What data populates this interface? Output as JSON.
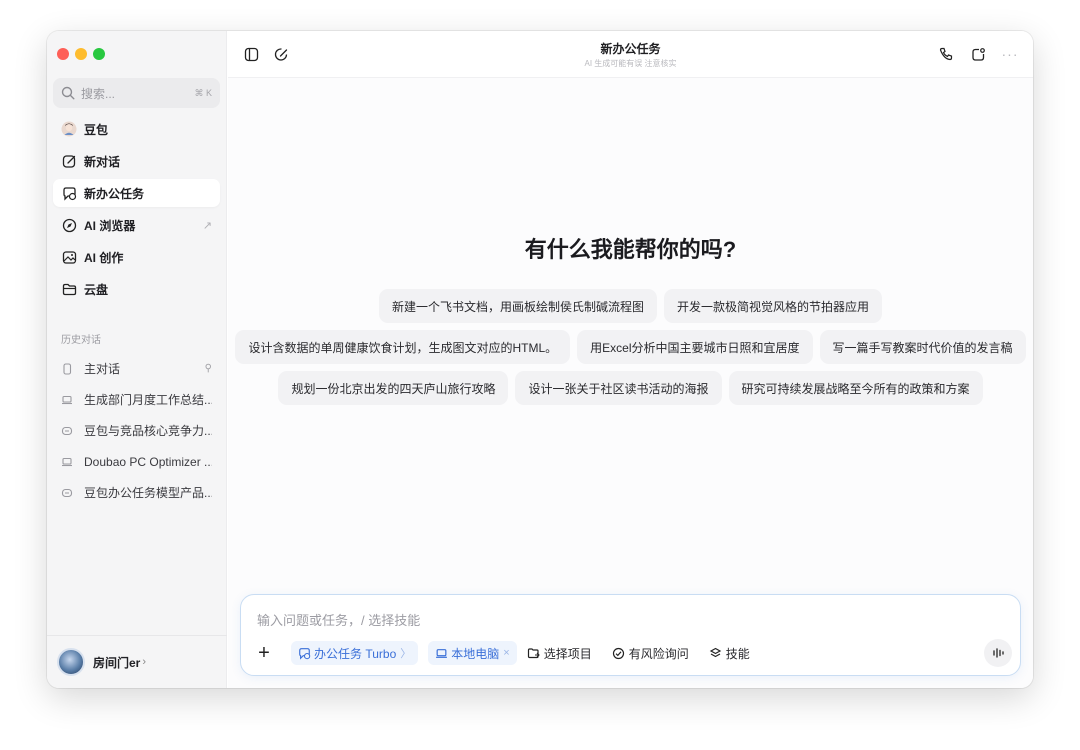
{
  "sidebar": {
    "search": {
      "placeholder": "搜索...",
      "shortcut": "⌘ K"
    },
    "nav": [
      {
        "label": "豆包",
        "icon": "doubao-avatar-icon"
      },
      {
        "label": "新对话",
        "icon": "new-chat-icon"
      },
      {
        "label": "新办公任务",
        "icon": "office-task-icon",
        "active": true
      },
      {
        "label": "AI 浏览器",
        "icon": "compass-icon",
        "ext": "↗"
      },
      {
        "label": "AI 创作",
        "icon": "image-icon"
      },
      {
        "label": "云盘",
        "icon": "folder-icon"
      }
    ],
    "history_title": "历史对话",
    "history": [
      {
        "label": "主对话",
        "icon": "phone-icon",
        "pin": "⚲"
      },
      {
        "label": "生成部门月度工作总结...",
        "icon": "laptop-icon"
      },
      {
        "label": "豆包与竞品核心竞争力...",
        "icon": "chat-bubble-icon"
      },
      {
        "label": "Doubao PC Optimizer ...",
        "icon": "laptop-icon"
      },
      {
        "label": "豆包办公任务模型产品...",
        "icon": "chat-bubble-icon"
      }
    ],
    "user": {
      "name": "房间门er",
      "chevron": "›"
    }
  },
  "header": {
    "title": "新办公任务",
    "subtitle": "AI 生成可能有误 注意核实"
  },
  "main": {
    "headline": "有什么我能帮你的吗?",
    "suggestions": [
      [
        "新建一个飞书文档，用画板绘制侯氏制碱流程图",
        "开发一款极简视觉风格的节拍器应用"
      ],
      [
        "设计含数据的单周健康饮食计划，生成图文对应的HTML。",
        "用Excel分析中国主要城市日照和宜居度",
        "写一篇手写教案时代价值的发言稿"
      ],
      [
        "规划一份北京出发的四天庐山旅行攻略",
        "设计一张关于社区读书活动的海报",
        "研究可持续发展战略至今所有的政策和方案"
      ]
    ]
  },
  "composer": {
    "placeholder": "输入问题或任务，/ 选择技能",
    "mode_tag": {
      "label": "办公任务 Turbo",
      "suffix": "〉"
    },
    "device_tag": {
      "label": "本地电脑",
      "suffix": "×"
    },
    "tools": [
      {
        "label": "选择项目",
        "icon": "project-icon"
      },
      {
        "label": "有风险询问",
        "icon": "check-circle-icon"
      },
      {
        "label": "技能",
        "icon": "skills-icon"
      }
    ]
  },
  "colors": {
    "accent": "#3a6fd8",
    "sidebar_bg": "#f5f5f6"
  }
}
